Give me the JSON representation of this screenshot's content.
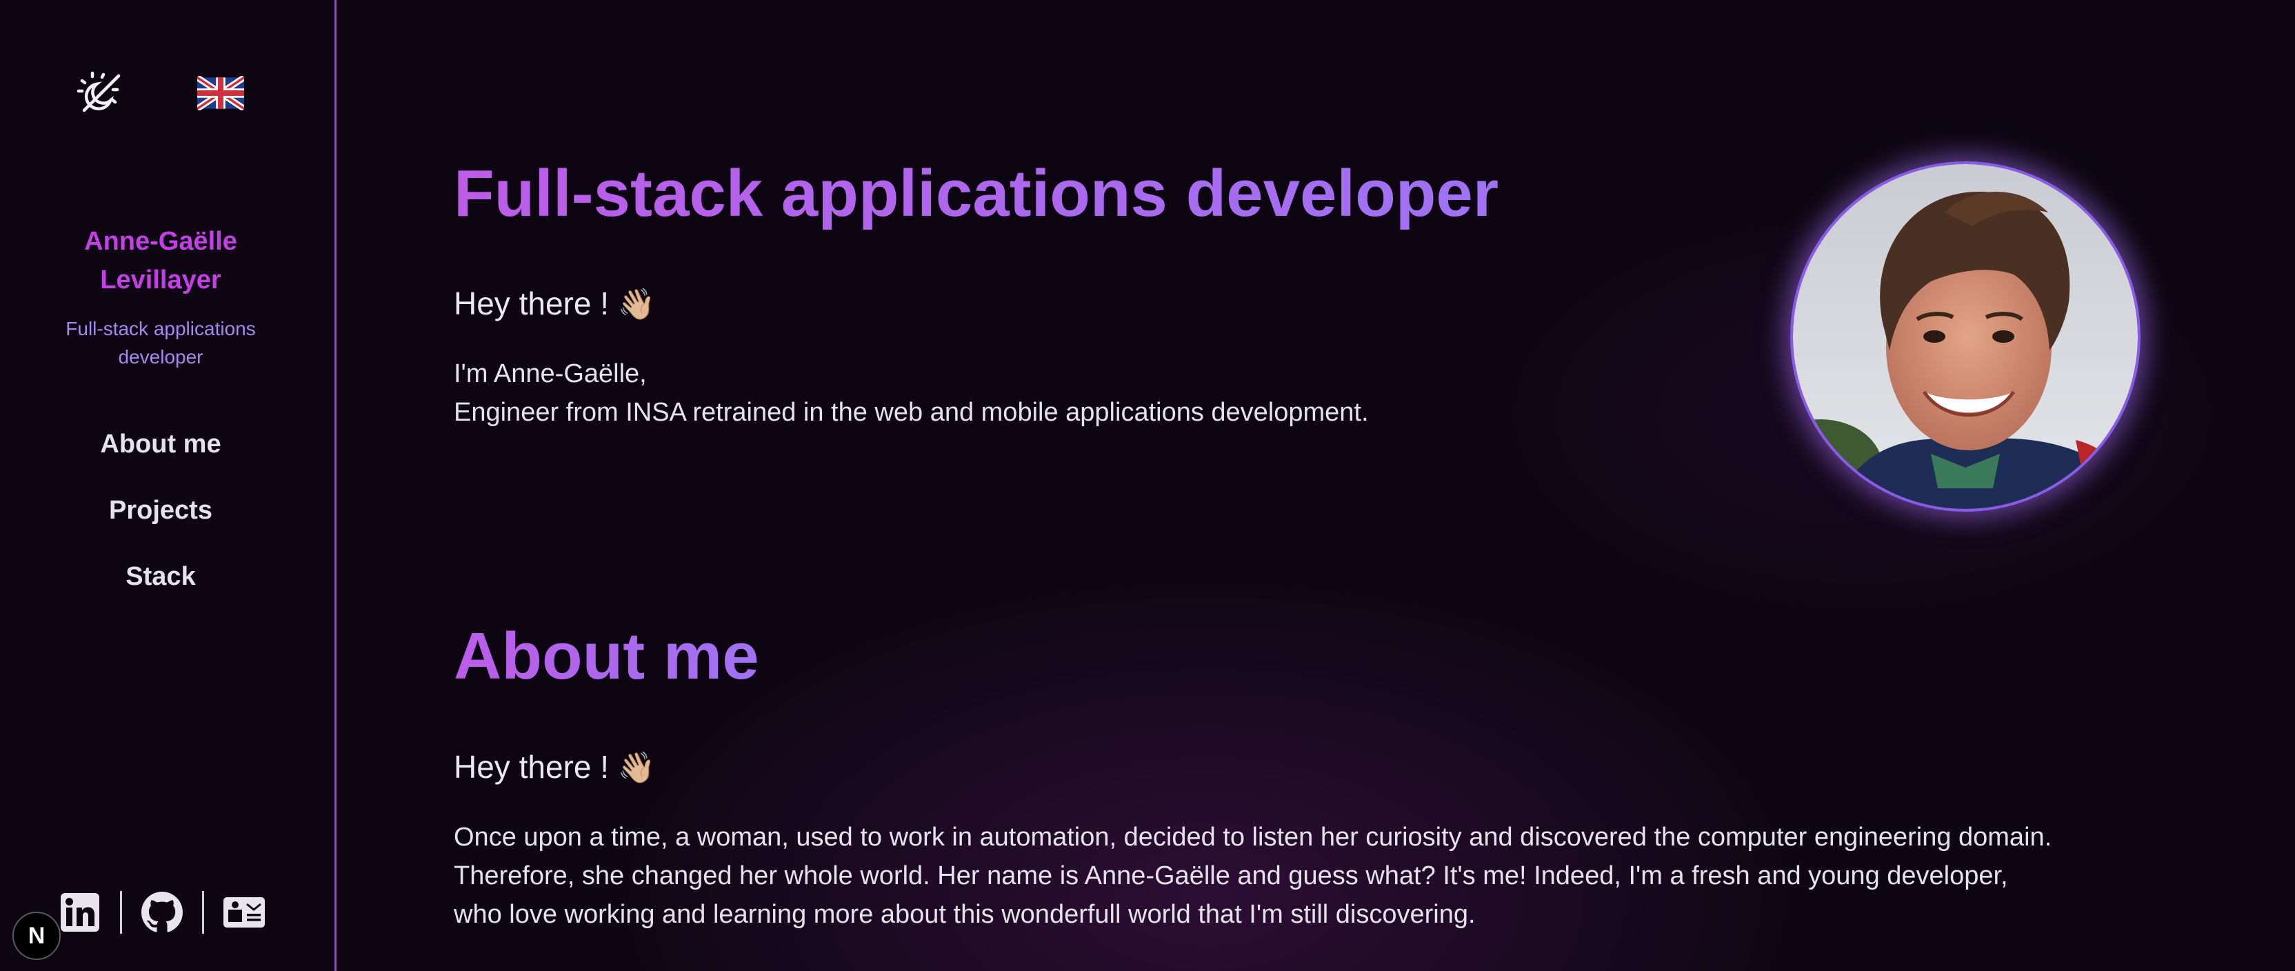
{
  "sidebar": {
    "theme_icon": "theme-toggle-icon",
    "lang_icon": "uk-flag-icon",
    "name_lines": [
      "Anne-Gaëlle",
      "Levillayer"
    ],
    "role_lines": [
      "Full-stack applications",
      "developer"
    ],
    "nav": [
      "About me",
      "Projects",
      "Stack"
    ],
    "socials": [
      "linkedin-icon",
      "github-icon",
      "contact-card-icon"
    ],
    "badge": "N"
  },
  "hero": {
    "title": "Full-stack applications developer",
    "greeting": "Hey there !",
    "wave": "👋🏼",
    "intro_lines": [
      "I'm Anne-Gaëlle,",
      "Engineer from INSA retrained in the web and mobile applications development."
    ]
  },
  "about": {
    "title": "About me",
    "greeting": "Hey there !",
    "wave": "👋🏼",
    "body_lines": [
      "Once upon a time, a woman, used to work in automation, decided to listen her curiosity and discovered the computer engineering domain.",
      "Therefore, she changed her whole world. Her name is Anne-Gaëlle and guess what? It's me! Indeed, I'm a fresh and young developer,",
      "who love working and learning more about this wonderfull world that I'm still discovering."
    ]
  },
  "colors": {
    "accent": "#c440e6",
    "title_gradient": [
      "#bc5ce8",
      "#9f72f2"
    ],
    "role": "#a38af0",
    "border": "#9b3fd6",
    "background": "#0d0612"
  }
}
